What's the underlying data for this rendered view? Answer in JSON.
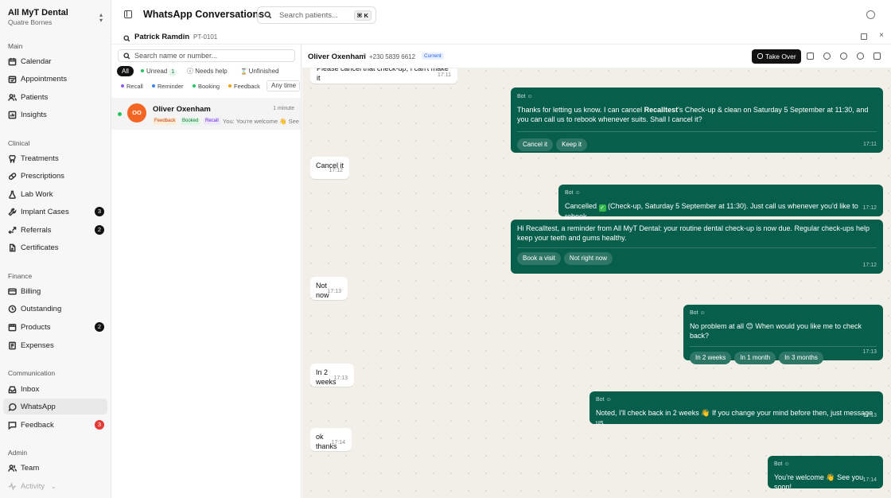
{
  "org": {
    "name": "All MyT Dental",
    "location": "Quatre Bornes"
  },
  "sidebar": {
    "sections": [
      "Main",
      "Clinical",
      "Finance",
      "Communication",
      "Admin"
    ],
    "items": [
      {
        "label": "Calendar",
        "icon": "calendar-icon"
      },
      {
        "label": "Appointments",
        "icon": "calendar-check-icon"
      },
      {
        "label": "Patients",
        "icon": "users-icon"
      },
      {
        "label": "Insights",
        "icon": "bar-chart-icon"
      },
      {
        "label": "Treatments",
        "icon": "tooth-icon"
      },
      {
        "label": "Prescriptions",
        "icon": "pill-icon"
      },
      {
        "label": "Lab Work",
        "icon": "flask-icon"
      },
      {
        "label": "Implant Cases",
        "icon": "wrench-icon",
        "badge": "3"
      },
      {
        "label": "Referrals",
        "icon": "share-icon",
        "badge": "2"
      },
      {
        "label": "Certificates",
        "icon": "file-icon"
      },
      {
        "label": "Billing",
        "icon": "credit-card-icon"
      },
      {
        "label": "Outstanding",
        "icon": "clock-icon"
      },
      {
        "label": "Products",
        "icon": "package-icon",
        "badge": "2"
      },
      {
        "label": "Expenses",
        "icon": "receipt-icon"
      },
      {
        "label": "Inbox",
        "icon": "inbox-icon"
      },
      {
        "label": "WhatsApp",
        "icon": "message-circle-icon"
      },
      {
        "label": "Feedback",
        "icon": "message-square-icon",
        "badge": "3"
      },
      {
        "label": "Team",
        "icon": "users-icon"
      },
      {
        "label": "Activity",
        "icon": "activity-icon"
      }
    ]
  },
  "header": {
    "title": "WhatsApp Conversations",
    "search_placeholder": "Search patients...",
    "shortcut": "⌘ K"
  },
  "patient": {
    "name": "Patrick Ramdin",
    "separator": "·",
    "id": "PT-0101"
  },
  "list": {
    "search_placeholder": "Search name or number...",
    "filters": {
      "all": "All",
      "unread": "Unread",
      "unread_count": "1",
      "needs_help": "Needs help",
      "unfinished": "Unfinished"
    },
    "tags": [
      "Recall",
      "Reminder",
      "Booking",
      "Feedback"
    ],
    "time_filter": "Any time",
    "conversations": [
      {
        "initials": "OO",
        "name": "Oliver Oxenham",
        "time": "1 minute",
        "tags": [
          "Feedback",
          "Booked",
          "Recall"
        ],
        "preview": "You: You're welcome 👋 See you soon!"
      }
    ]
  },
  "chat": {
    "contact": "Oliver Oxenham",
    "arrow": "↗",
    "phone": "+230 5839 6612",
    "status": "Current",
    "take_over": "Take Over",
    "messages": [
      {
        "dir": "in",
        "text": "Please cancel that check-up, I can't make it",
        "time": "17:11"
      },
      {
        "dir": "out",
        "bot": "Bot",
        "html_parts": [
          "Thanks for letting us know. I can cancel ",
          "Recalltest",
          "'s Check-up & clean on Saturday 5 September at 11:30, and you can call us to rebook whenever suits. Shall I cancel it?"
        ],
        "replies": [
          "Cancel it",
          "Keep it"
        ],
        "time": "17:11"
      },
      {
        "dir": "in",
        "text": "Cancel it",
        "time": "17:12"
      },
      {
        "dir": "out",
        "bot": "Bot",
        "text_a": "Cancelled",
        "text_b": "(Check-up, Saturday 5 September at 11:30). Just call us whenever you'd like to rebook.",
        "time": "17:12"
      },
      {
        "dir": "out",
        "text": "Hi Recalltest, a reminder from All MyT Dental: your routine dental check-up is now due. Regular check-ups help keep your teeth and gums healthy.",
        "replies": [
          "Book a visit",
          "Not right now"
        ],
        "time": "17:12"
      },
      {
        "dir": "in",
        "text": "Not now",
        "time": "17:13"
      },
      {
        "dir": "out",
        "bot": "Bot",
        "text": "No problem at all 😊 When would you like me to check back?",
        "replies": [
          "In 2 weeks",
          "In 1 month",
          "In 3 months"
        ],
        "time": "17:13"
      },
      {
        "dir": "in",
        "text": "In 2 weeks",
        "time": "17:13"
      },
      {
        "dir": "out",
        "bot": "Bot",
        "text": "Noted, I'll check back in 2 weeks 👋 If you change your mind before then, just message us.",
        "time": "17:13"
      },
      {
        "dir": "in",
        "text": "ok thanks",
        "time": "17:14"
      },
      {
        "dir": "out",
        "bot": "Bot",
        "text": "You're welcome 👋 See you soon!",
        "time": "17:14"
      }
    ]
  },
  "colors": {
    "bubble_out": "#075e4a",
    "chat_bg": "#f2eee8",
    "avatar": "#f26522",
    "badge_red": "#e53935"
  }
}
